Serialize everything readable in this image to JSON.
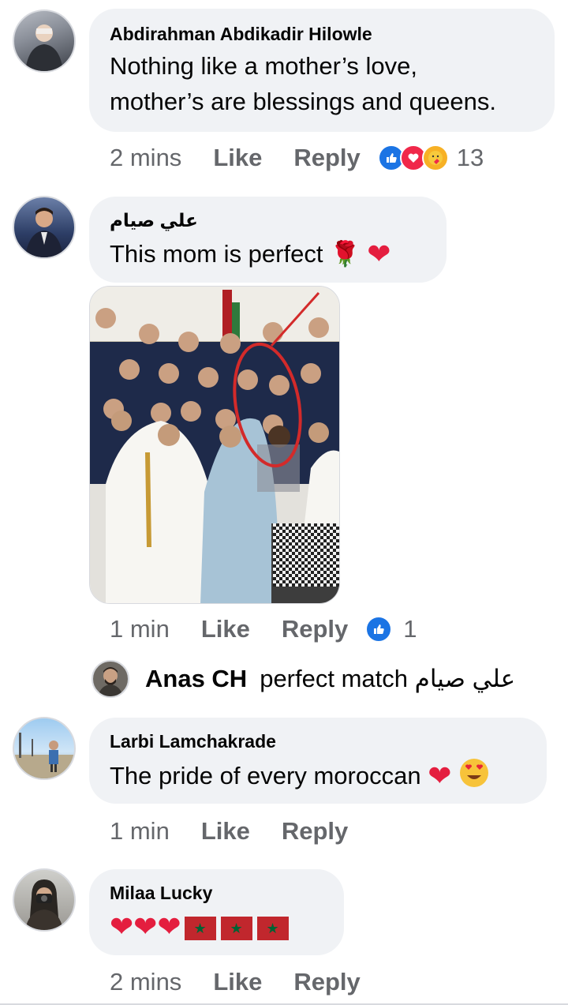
{
  "comments": [
    {
      "author": "Abdirahman Abdikadir Hilowle",
      "text_line1": "Nothing like a mother’s love,",
      "text_line2": "mother’s are blessings and queens.",
      "time": "2 mins",
      "like": "Like",
      "reply": "Reply",
      "reaction_icons": [
        "like-icon",
        "love-icon",
        "care-icon"
      ],
      "reaction_count": "13"
    },
    {
      "author": "علي صيام",
      "text": "This mom is perfect 🌹",
      "time": "1 min",
      "like": "Like",
      "reply": "Reply",
      "reaction_icons": [
        "like-icon"
      ],
      "reaction_count": "1"
    },
    {
      "author": "Larbi Lamchakrade",
      "text": "The pride of every moroccan",
      "time": "1 min",
      "like": "Like",
      "reply": "Reply"
    },
    {
      "author": "Milaa Lucky",
      "time": "2 mins",
      "like": "Like",
      "reply": "Reply"
    }
  ],
  "reply": {
    "author": "Anas CH",
    "text": "perfect match علي صيام"
  },
  "colors": {
    "bubble": "#f0f2f5",
    "meta": "#65676b",
    "like_blue": "#1b74e4",
    "heart_red": "#e41e3f"
  }
}
